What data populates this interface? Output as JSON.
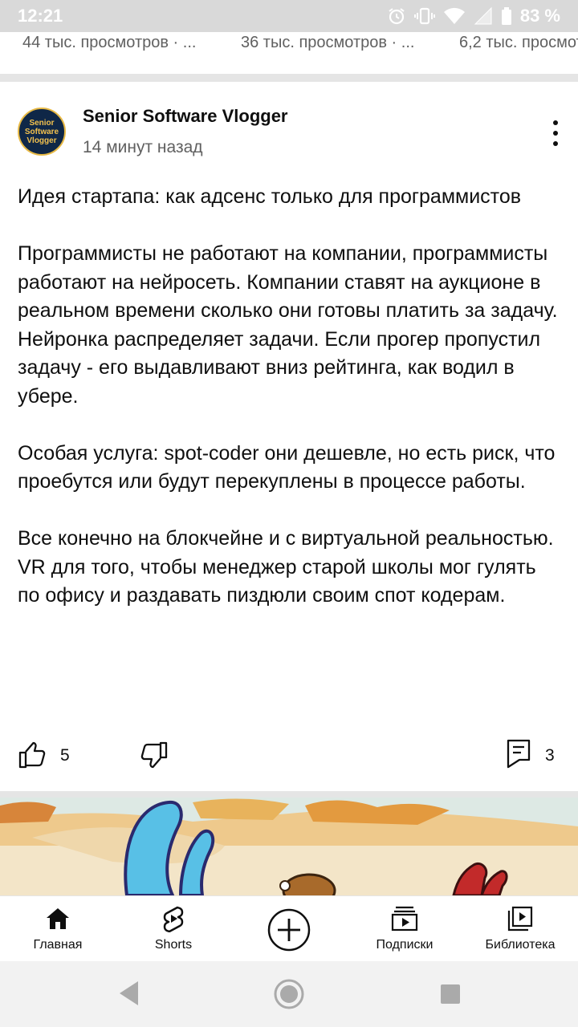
{
  "status_bar": {
    "time": "12:21",
    "battery": "83 %"
  },
  "views_strip": {
    "items": [
      "44 тыс. просмотров · ...",
      "36 тыс. просмотров · ...",
      "6,2 тыс. просмотр"
    ]
  },
  "post": {
    "channel_name": "Senior Software Vlogger",
    "avatar_text": [
      "Senior",
      "Software",
      "Vlogger"
    ],
    "time_ago": "14 минут назад",
    "paragraphs": [
      "Идея стартапа: как адсенс только для программистов",
      "Программисты не работают на компании, программисты работают на нейросеть. Компании ставят на аукционе в реальном времени сколько они готовы платить за задачу. Нейронка распределяет задачи. Если прогер пропустил задачу - его выдавливают вниз рейтинга, как водил в убере.",
      "Особая услуга: spot-coder они дешевле, но есть риск, что проебутся или будут перекуплены в процессе работы.",
      "Все конечно на блокчейне и с виртуальной реальностью. VR для того, чтобы менеджер старой школы мог гулять по офису и раздавать пиздюли своим спот кодерам."
    ],
    "likes": "5",
    "comments": "3"
  },
  "bottom_nav": {
    "home": "Главная",
    "shorts": "Shorts",
    "subscriptions": "Подписки",
    "library": "Библиотека"
  }
}
